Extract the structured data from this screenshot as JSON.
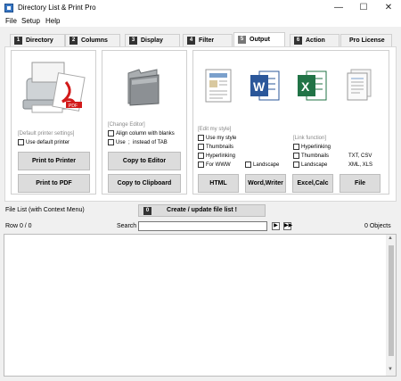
{
  "window": {
    "title": "Directory List & Print Pro"
  },
  "menu": [
    "File",
    "Setup",
    "Help"
  ],
  "tabs": [
    {
      "num": "1",
      "label": "Directory"
    },
    {
      "num": "2",
      "label": "Columns"
    },
    {
      "num": "3",
      "label": "Display"
    },
    {
      "num": "4",
      "label": "Filter"
    },
    {
      "num": "5",
      "label": "Output"
    },
    {
      "num": "6",
      "label": "Action"
    },
    {
      "num": "",
      "label": "Pro License"
    }
  ],
  "printer_group": {
    "section_label": "[Default printer settings]",
    "use_default_printer": "Use default printer",
    "print_to_printer": "Print to Printer",
    "print_to_pdf": "Print to PDF",
    "icon": "printer-pdf-icon"
  },
  "editor_group": {
    "section_label": "[Change Editor]",
    "align_column": "Align column with blanks",
    "use_instead_of_tab": "Use  ;  instead of TAB",
    "copy_to_editor": "Copy to Editor",
    "copy_to_clipboard": "Copy to Clipboard",
    "icon": "folder-icon"
  },
  "export_group": {
    "edit_style_label": "[Edit my style]",
    "link_function_label": "[Link function]",
    "use_my_style": "Use my style",
    "thumbnails": "Thumbnails",
    "hyperlinking": "Hyperlinking",
    "for_www": "For WWW",
    "landscape": "Landscape",
    "word_hyperlinking": "Hyperlinking",
    "word_thumbnails": "Thumbnails",
    "word_landscape": "Landscape",
    "txt_csv": "TXT, CSV",
    "xml_xls": "XML, XLS",
    "html_btn": "HTML",
    "word_btn": "Word,Writer",
    "excel_btn": "Excel,Calc",
    "file_btn": "File"
  },
  "file_list": {
    "label": "File List (with Context Menu)",
    "create_btn_num": "0",
    "create_btn": "Create / update file list !",
    "row_info": "Row 0 / 0",
    "search_label": "Search",
    "search_value": "",
    "objects": "0 Objects"
  }
}
